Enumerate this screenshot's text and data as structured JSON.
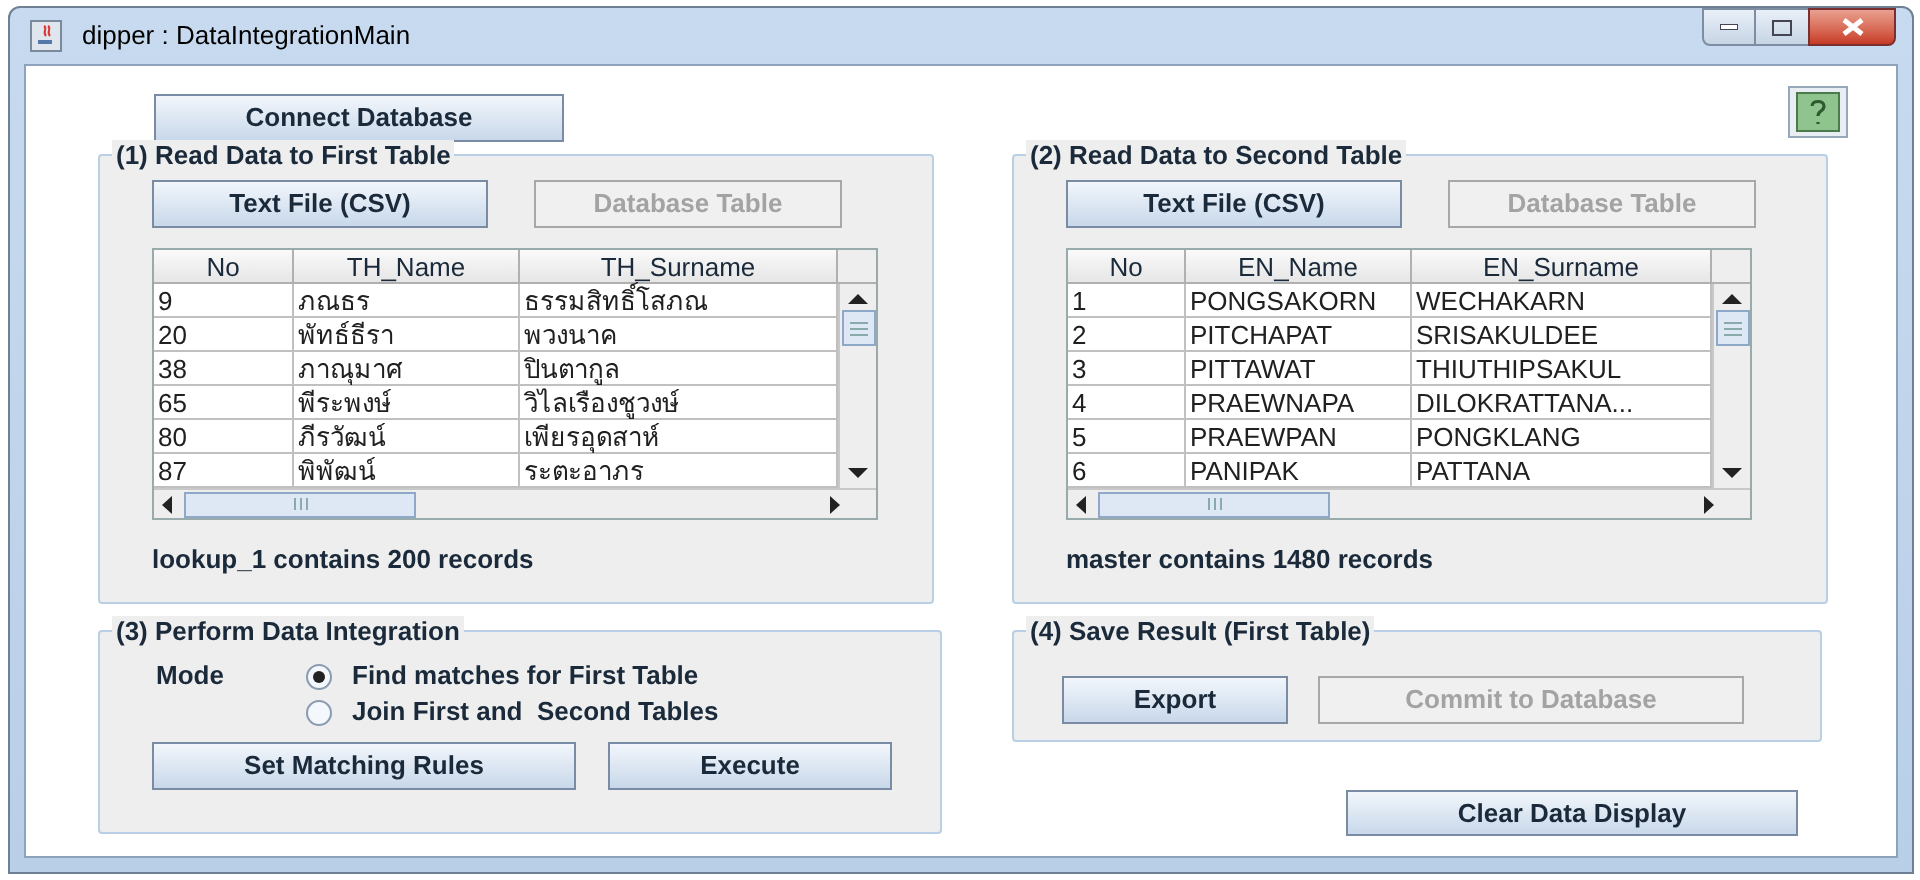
{
  "window": {
    "title": "dipper : DataIntegrationMain"
  },
  "connect_button": {
    "label": "Connect Database"
  },
  "read_panels": [
    {
      "title": "(1)  Read Data to First Table",
      "buttons": [
        {
          "label": "Text File (CSV)",
          "disabled": false
        },
        {
          "label": "Database Table",
          "disabled": true
        }
      ],
      "table": {
        "columns": [
          "No",
          "TH_Name",
          "TH_Surname"
        ],
        "rows": [
          [
            "9",
            "ภณธร",
            "ธรรมสิทธิ์โสภณ"
          ],
          [
            "20",
            "พัทธ์ธีรา",
            "พวงนาค"
          ],
          [
            "38",
            "ภาณุมาศ",
            "ปินตากูล"
          ],
          [
            "65",
            "พีระพงษ์",
            "วิไลเรืองชูวงษ์"
          ],
          [
            "80",
            "ภีรวัฒน์",
            "เพียรอุดสาห์"
          ],
          [
            "87",
            "พิพัฒน์",
            "ระตะอาภร"
          ]
        ]
      },
      "status": "lookup_1 contains 200 records"
    },
    {
      "title": "(2)  Read Data to Second Table",
      "buttons": [
        {
          "label": "Text File (CSV)",
          "disabled": false
        },
        {
          "label": "Database Table",
          "disabled": true
        }
      ],
      "table": {
        "columns": [
          "No",
          "EN_Name",
          "EN_Surname"
        ],
        "rows": [
          [
            "1",
            "PONGSAKORN",
            "WECHAKARN"
          ],
          [
            "2",
            "PITCHAPAT",
            "SRISAKULDEE"
          ],
          [
            "3",
            "PITTAWAT",
            "THIUTHIPSAKUL"
          ],
          [
            "4",
            "PRAEWNAPA",
            "DILOKRATTANA..."
          ],
          [
            "5",
            "PRAEWPAN",
            "PONGKLANG"
          ],
          [
            "6",
            "PANIPAK",
            "PATTANA"
          ]
        ]
      },
      "status": "master contains 1480 records"
    }
  ],
  "integration": {
    "title": "(3)  Perform Data Integration",
    "mode_label": "Mode",
    "options": [
      {
        "label": "Find matches for First Table",
        "selected": true
      },
      {
        "label": "Join First and  Second Tables",
        "selected": false
      }
    ],
    "buttons": [
      {
        "label": "Set Matching Rules",
        "disabled": false
      },
      {
        "label": "Execute",
        "disabled": false
      }
    ]
  },
  "save": {
    "title": "(4)  Save Result (First Table)",
    "buttons": [
      {
        "label": "Export",
        "disabled": false
      },
      {
        "label": "Commit to Database",
        "disabled": true
      }
    ]
  },
  "clear_button": {
    "label": "Clear Data Display"
  }
}
